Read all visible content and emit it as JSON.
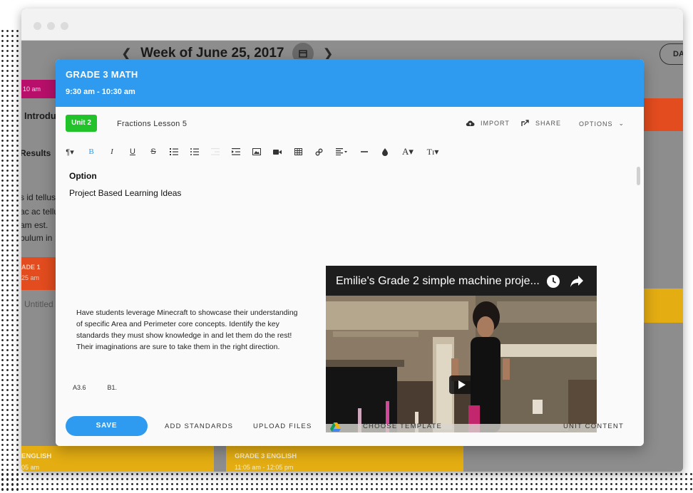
{
  "calendar": {
    "week_title": "Week of June 25, 2017",
    "view_button": "DA",
    "left_col": {
      "time_chip": "10 am",
      "intro": "Introdu",
      "results": "Results",
      "text_lines": [
        "s id tellus",
        "ac ac tellu",
        "am est.",
        "bulum in"
      ],
      "grade_chip": "ADE 1",
      "grade_time": "25 am",
      "untitled": "Untitled"
    },
    "bottom_events": [
      {
        "title": "ENGLISH",
        "time": "05 am"
      },
      {
        "title": "GRADE 3 ENGLISH",
        "time": "11:05 am - 12:05 pm"
      }
    ]
  },
  "modal": {
    "title": "GRADE 3 MATH",
    "time": "9:30 am - 10:30 am",
    "unit_badge": "Unit 2",
    "lesson_name": "Fractions Lesson 5",
    "import_label": "IMPORT",
    "share_label": "SHARE",
    "options_label": "OPTIONS",
    "toolbar": [
      "paragraph-icon",
      "bold-icon",
      "italic-icon",
      "underline-icon",
      "strikethrough-icon",
      "ordered-list-icon",
      "unordered-list-icon",
      "outdent-icon",
      "indent-icon",
      "image-icon",
      "video-icon",
      "table-icon",
      "link-icon",
      "align-icon",
      "hr-icon",
      "color-icon",
      "font-size-icon",
      "text-size-icon"
    ],
    "editor": {
      "heading": "Option",
      "subheading": "Project Based Learning Ideas",
      "paragraph": "Have students leverage Minecraft to showcase their understanding of specific Area and Perimeter core concepts. Identify the key standards they must show knowledge in and let them do the rest! Their imaginations are sure to take them in the right direction.",
      "standards": [
        "A3.6",
        "B1."
      ]
    },
    "video": {
      "title": "Emilie's Grade 2 simple machine proje..."
    },
    "footer": {
      "save": "SAVE",
      "add_standards": "ADD STANDARDS",
      "upload_files": "UPLOAD FILES",
      "choose_template": "CHOOSE TEMPLATE",
      "unit_content": "UNIT CONTENT"
    }
  },
  "colors": {
    "accent": "#2e9bf0",
    "unit_green": "#22c32a",
    "magenta": "#c0106f",
    "orange": "#e24c1e",
    "yellow": "#e4ad12"
  }
}
